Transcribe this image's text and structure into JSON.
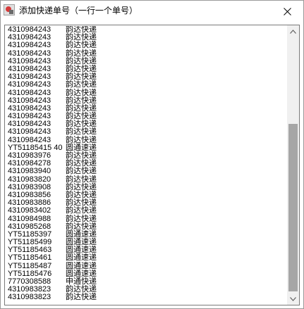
{
  "window": {
    "title": "添加快递单号（一行一个单号）"
  },
  "icons": {
    "app": "app-icon",
    "close": "close-icon",
    "scroll_up": "chevron-up-icon",
    "scroll_down": "chevron-down-icon"
  },
  "scrollbar": {
    "position_fraction": 0.55
  },
  "colors": {
    "thumb": "#a6a6a6",
    "track": "#f0f0f0"
  },
  "tracking_list": [
    {
      "number": "4310984243",
      "courier": "韵达快递"
    },
    {
      "number": "4310984243",
      "courier": "韵达快递"
    },
    {
      "number": "4310984243",
      "courier": "韵达快递"
    },
    {
      "number": "4310984243",
      "courier": "韵达快递"
    },
    {
      "number": "4310984243",
      "courier": "韵达快递"
    },
    {
      "number": "4310984243",
      "courier": "韵达快递"
    },
    {
      "number": "4310984243",
      "courier": "韵达快递"
    },
    {
      "number": "4310984243",
      "courier": "韵达快递"
    },
    {
      "number": "4310984243",
      "courier": "韵达快递"
    },
    {
      "number": "4310984243",
      "courier": "韵达快递"
    },
    {
      "number": "4310984243",
      "courier": "韵达快递"
    },
    {
      "number": "4310984243",
      "courier": "韵达快递"
    },
    {
      "number": "4310984243",
      "courier": "韵达快递"
    },
    {
      "number": "4310984243",
      "courier": "韵达快递"
    },
    {
      "number": "4310984243",
      "courier": "韵达快递"
    },
    {
      "number": "YT51185415   40",
      "courier": "圆通速递"
    },
    {
      "number": "4310983976",
      "courier": "韵达快递"
    },
    {
      "number": "4310984278",
      "courier": "韵达快递"
    },
    {
      "number": "4310983940",
      "courier": "韵达快递"
    },
    {
      "number": "4310983820",
      "courier": "韵达快递"
    },
    {
      "number": "4310983908",
      "courier": "韵达快递"
    },
    {
      "number": "4310983856",
      "courier": "韵达快递"
    },
    {
      "number": "4310983886",
      "courier": "韵达快递"
    },
    {
      "number": "4310983402",
      "courier": "韵达快递"
    },
    {
      "number": "4310984988",
      "courier": "韵达快递"
    },
    {
      "number": "4310985268",
      "courier": "韵达快递"
    },
    {
      "number": "YT51185397",
      "courier": "圆通速递"
    },
    {
      "number": "YT51185499",
      "courier": "圆通速递"
    },
    {
      "number": "YT51185463",
      "courier": "圆通速递"
    },
    {
      "number": "YT51185461",
      "courier": "圆通速递"
    },
    {
      "number": "YT51185487",
      "courier": "圆通速递"
    },
    {
      "number": "YT51185476",
      "courier": "圆通速递"
    },
    {
      "number": "7770308588",
      "courier": "申通快递"
    },
    {
      "number": "4310983823",
      "courier": "韵达快递"
    },
    {
      "number": "4310983823",
      "courier": "韵达快递"
    }
  ]
}
